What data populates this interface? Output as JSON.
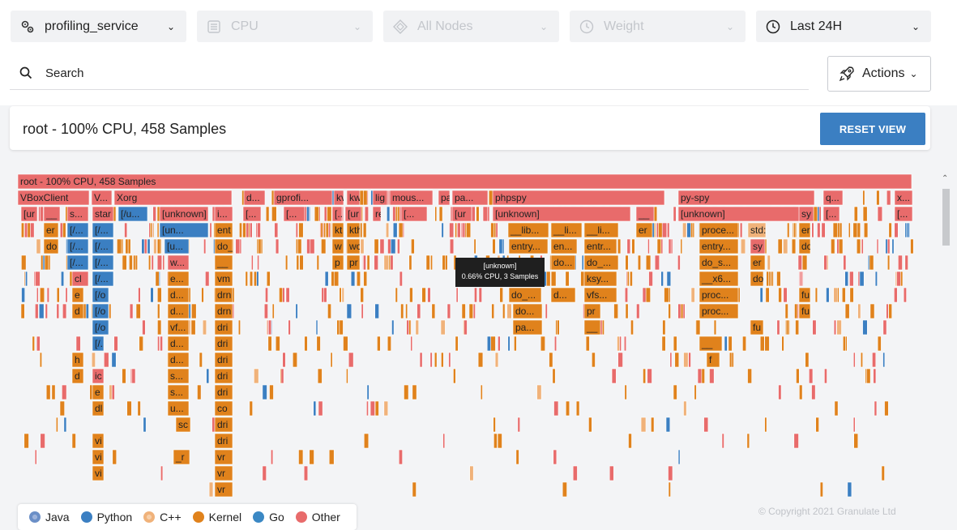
{
  "filters": {
    "service": {
      "label": "profiling_service",
      "icon": "gears-icon"
    },
    "metric": {
      "label": "CPU",
      "icon": "list-icon"
    },
    "nodes": {
      "label": "All Nodes",
      "icon": "nodes-icon"
    },
    "weight": {
      "label": "Weight",
      "icon": "clock-icon"
    },
    "time": {
      "label": "Last 24H",
      "icon": "clock-icon"
    }
  },
  "search": {
    "placeholder": "Search"
  },
  "actions": {
    "label": "Actions"
  },
  "title": {
    "text": "root - 100% CPU, 458 Samples",
    "reset_label": "RESET VIEW"
  },
  "tooltip": {
    "name": "[unknown]",
    "detail": "0.66% CPU, 3 Samples"
  },
  "legend": [
    {
      "label": "Java",
      "color": "#6b8fc7"
    },
    {
      "label": "Python",
      "color": "#3b7fc2"
    },
    {
      "label": "C++",
      "color": "#f0b27a"
    },
    {
      "label": "Kernel",
      "color": "#e0821c"
    },
    {
      "label": "Go",
      "color": "#3b88c4"
    },
    {
      "label": "Other",
      "color": "#e86b6b"
    }
  ],
  "copyright": "© Copyright 2021 Granulate Ltd",
  "colors": {
    "other": "#e86b6b",
    "kernel": "#e0821c",
    "python": "#3b7fc2",
    "cpp": "#f0b27a",
    "accent": "#3b7fc2"
  },
  "flamegraph": {
    "root": "root - 100% CPU, 458 Samples",
    "row1": [
      {
        "t": "VBoxClient"
      },
      {
        "t": "V..."
      },
      {
        "t": "Xorg"
      },
      {
        "t": "d..."
      },
      {
        "t": "gprofi..."
      },
      {
        "t": "kv"
      },
      {
        "t": "kw"
      },
      {
        "t": "lig"
      },
      {
        "t": "mous..."
      },
      {
        "t": "pa"
      },
      {
        "t": "pa..."
      },
      {
        "t": "phpspy"
      },
      {
        "t": "py-spy"
      },
      {
        "t": "q..."
      },
      {
        "t": "x..."
      }
    ],
    "row2": [
      {
        "t": "[ur"
      },
      {
        "t": "__"
      },
      {
        "t": "s..."
      },
      {
        "t": "star"
      },
      {
        "t": "[/u..."
      },
      {
        "t": "[unknown]"
      },
      {
        "t": "i..."
      },
      {
        "t": "[..."
      },
      {
        "t": "[..."
      },
      {
        "t": "[..."
      },
      {
        "t": "[ur"
      },
      {
        "t": "re"
      },
      {
        "t": "[..."
      },
      {
        "t": "[u..."
      },
      {
        "t": "[u..."
      },
      {
        "t": "[ur"
      },
      {
        "t": "[unknown]"
      },
      {
        "t": "__"
      },
      {
        "t": "[unknown]"
      },
      {
        "t": "sy"
      },
      {
        "t": "[..."
      },
      {
        "t": "[..."
      }
    ],
    "row3": [
      {
        "t": "er"
      },
      {
        "t": "[/..."
      },
      {
        "t": "[/..."
      },
      {
        "t": "[un..."
      },
      {
        "t": "ent"
      },
      {
        "t": "kt"
      },
      {
        "t": "kth"
      },
      {
        "t": "__lib..."
      },
      {
        "t": "__li..."
      },
      {
        "t": "__li..."
      },
      {
        "t": "er"
      },
      {
        "t": "proce..."
      },
      {
        "t": "std:"
      },
      {
        "t": "er"
      }
    ],
    "row4": [
      {
        "t": "do"
      },
      {
        "t": "[/..."
      },
      {
        "t": "[/..."
      },
      {
        "t": "[u..."
      },
      {
        "t": "do_"
      },
      {
        "t": "w"
      },
      {
        "t": "wo"
      },
      {
        "t": "entry..."
      },
      {
        "t": "en..."
      },
      {
        "t": "entr..."
      },
      {
        "t": "entry..."
      },
      {
        "t": "sy"
      },
      {
        "t": "do"
      }
    ],
    "row5": [
      {
        "t": "[/..."
      },
      {
        "t": "[/..."
      },
      {
        "t": "w..."
      },
      {
        "t": "__"
      },
      {
        "t": "p"
      },
      {
        "t": "pr"
      },
      {
        "t": "do..."
      },
      {
        "t": "do_..."
      },
      {
        "t": "do_s..."
      },
      {
        "t": "er"
      }
    ],
    "row6": [
      {
        "t": "cl"
      },
      {
        "t": "[/..."
      },
      {
        "t": "e..."
      },
      {
        "t": "vm"
      },
      {
        "t": "do_..."
      },
      {
        "t": "ksy..."
      },
      {
        "t": "__x6..."
      },
      {
        "t": "do"
      }
    ],
    "row7": [
      {
        "t": "e"
      },
      {
        "t": "[/o"
      },
      {
        "t": "d..."
      },
      {
        "t": "drn"
      },
      {
        "t": "do_..."
      },
      {
        "t": "d..."
      },
      {
        "t": "vfs..."
      },
      {
        "t": "proc..."
      },
      {
        "t": "fu"
      }
    ],
    "row8": [
      {
        "t": "d"
      },
      {
        "t": "[/o"
      },
      {
        "t": "d..."
      },
      {
        "t": "drn"
      },
      {
        "t": "do..."
      },
      {
        "t": "pr"
      },
      {
        "t": "proc..."
      },
      {
        "t": "fu"
      }
    ],
    "row9": [
      {
        "t": "[/o"
      },
      {
        "t": "vf..."
      },
      {
        "t": "dri"
      },
      {
        "t": "pa..."
      },
      {
        "t": "__"
      },
      {
        "t": "fu"
      }
    ],
    "row10": [
      {
        "t": "[/..."
      },
      {
        "t": "d..."
      },
      {
        "t": "dri"
      },
      {
        "t": "__"
      }
    ],
    "row11": [
      {
        "t": "h"
      },
      {
        "t": "d..."
      },
      {
        "t": "dri"
      },
      {
        "t": "f"
      }
    ],
    "row12": [
      {
        "t": "d"
      },
      {
        "t": "ic"
      },
      {
        "t": "s..."
      },
      {
        "t": "dri"
      }
    ],
    "row13": [
      {
        "t": "e"
      },
      {
        "t": "s..."
      },
      {
        "t": "dri"
      }
    ],
    "row14": [
      {
        "t": "dl"
      },
      {
        "t": "u..."
      },
      {
        "t": "co"
      }
    ],
    "row15": [
      {
        "t": "sc"
      },
      {
        "t": "dri"
      }
    ],
    "row16": [
      {
        "t": "vi"
      },
      {
        "t": "dri"
      }
    ],
    "row17": [
      {
        "t": "vi"
      },
      {
        "t": "_r"
      },
      {
        "t": "vr"
      }
    ],
    "row18": [
      {
        "t": "vi"
      },
      {
        "t": "vr"
      }
    ],
    "row19": [
      {
        "t": "vr"
      }
    ]
  }
}
